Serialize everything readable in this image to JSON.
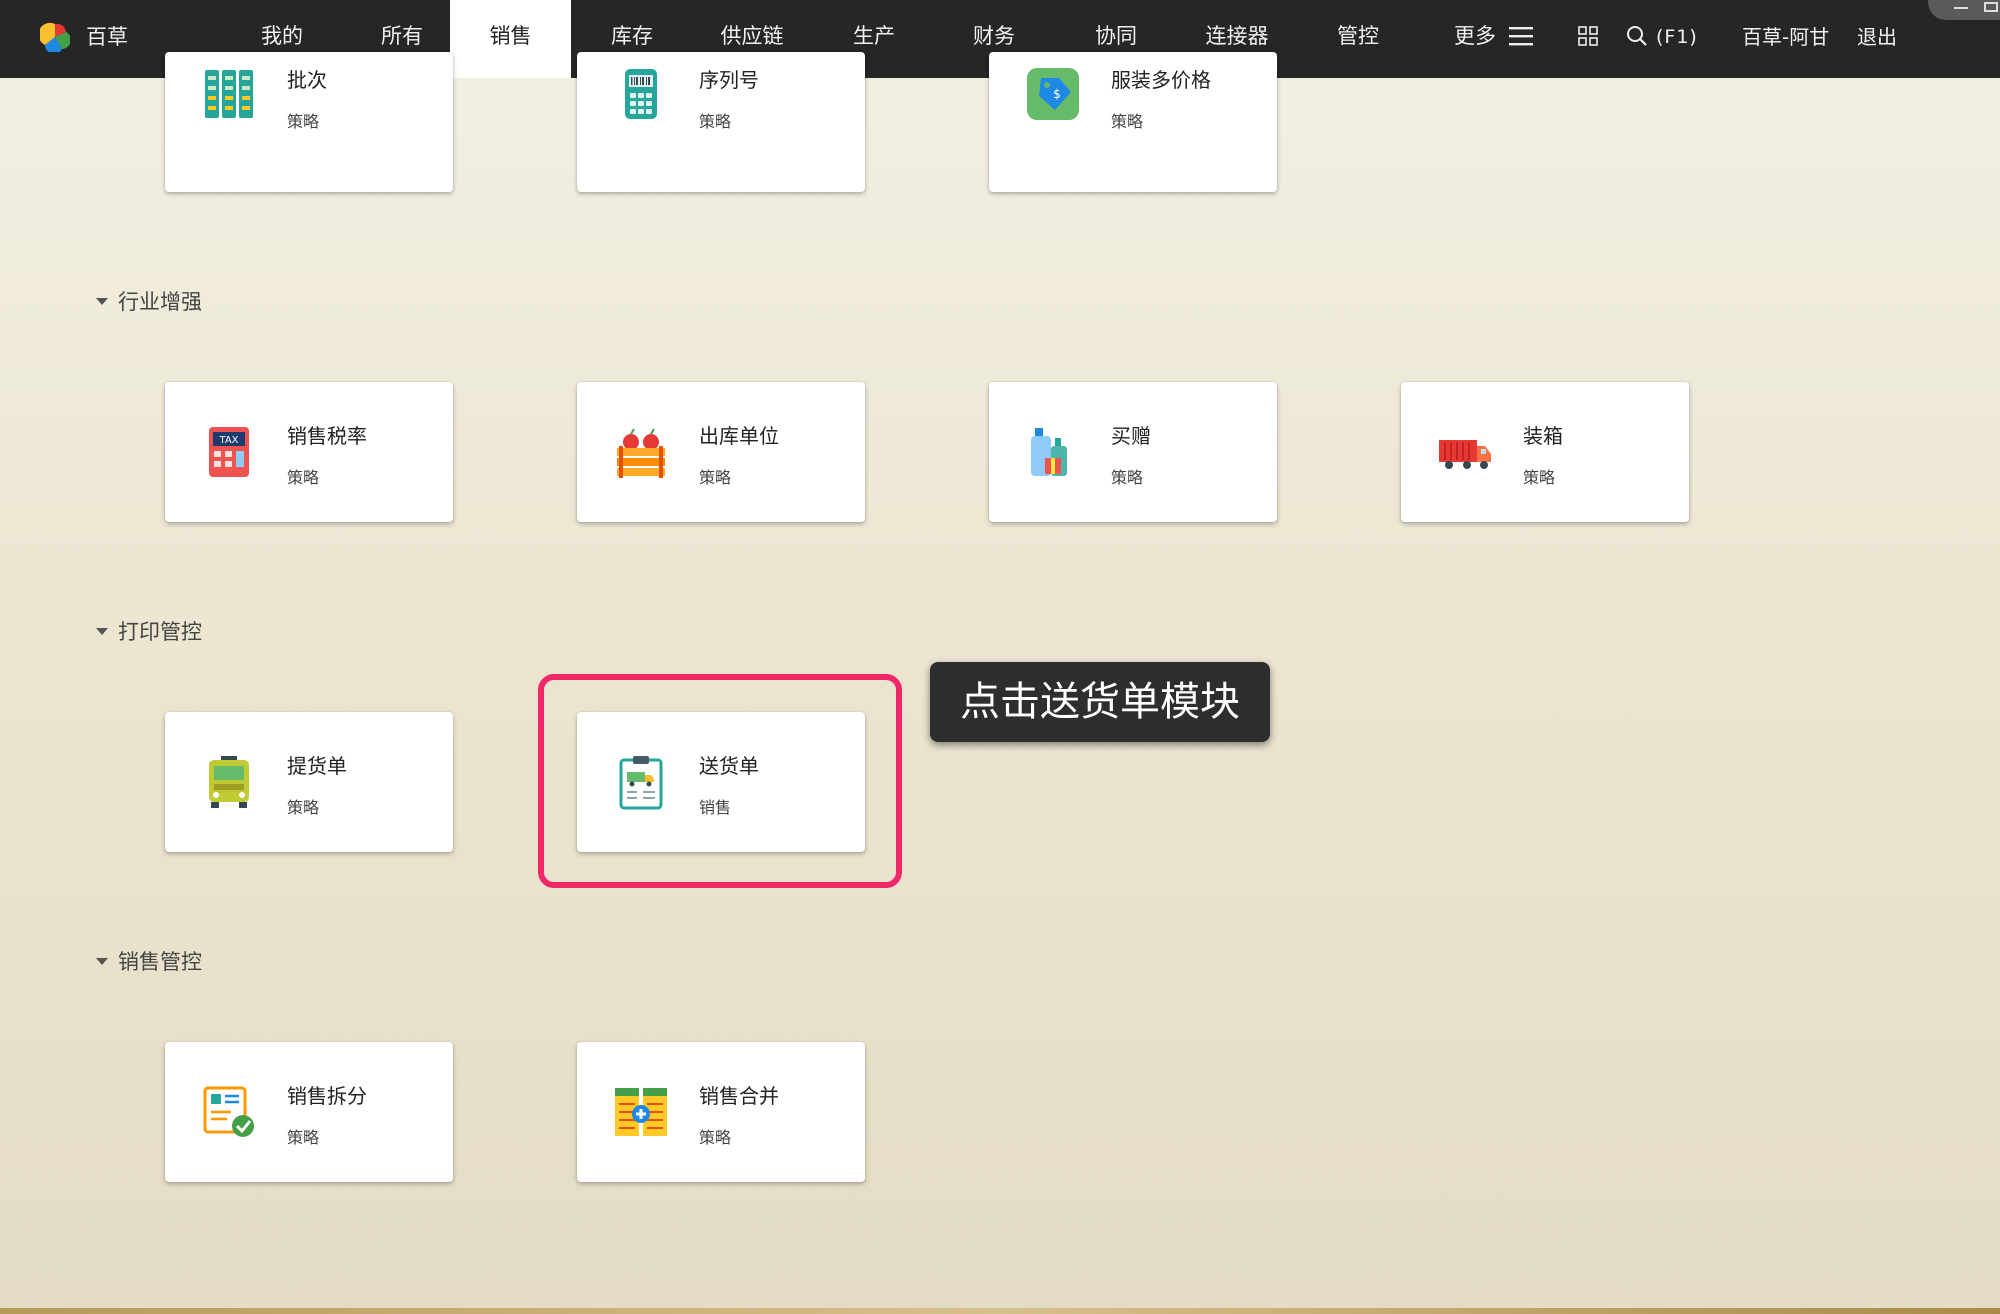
{
  "app": {
    "brand": "百草"
  },
  "nav": {
    "items": [
      {
        "label": "我的"
      },
      {
        "label": "所有"
      },
      {
        "label": "销售",
        "active": true
      },
      {
        "label": "库存"
      },
      {
        "label": "供应链"
      },
      {
        "label": "生产"
      },
      {
        "label": "财务"
      },
      {
        "label": "协同"
      },
      {
        "label": "连接器"
      },
      {
        "label": "管控"
      },
      {
        "label": "更多"
      }
    ],
    "search_shortcut": "(F1)",
    "user": "百草-阿甘",
    "logout": "退出"
  },
  "top_row": [
    {
      "title": "批次",
      "sub": "策略",
      "icon": "batch-icon"
    },
    {
      "title": "序列号",
      "sub": "策略",
      "icon": "serial-scanner-icon"
    },
    {
      "title": "服装多价格",
      "sub": "策略",
      "icon": "price-tag-icon"
    }
  ],
  "sections": [
    {
      "title": "行业增强",
      "cards": [
        {
          "title": "销售税率",
          "sub": "策略",
          "icon": "tax-calculator-icon",
          "icon_text": "TAX"
        },
        {
          "title": "出库单位",
          "sub": "策略",
          "icon": "fruit-crate-icon"
        },
        {
          "title": "买赠",
          "sub": "策略",
          "icon": "gift-bottles-icon"
        },
        {
          "title": "装箱",
          "sub": "策略",
          "icon": "truck-icon"
        }
      ]
    },
    {
      "title": "打印管控",
      "cards": [
        {
          "title": "提货单",
          "sub": "策略",
          "icon": "bus-icon"
        },
        {
          "title": "送货单",
          "sub": "销售",
          "icon": "delivery-clipboard-icon"
        }
      ]
    },
    {
      "title": "销售管控",
      "cards": [
        {
          "title": "销售拆分",
          "sub": "策略",
          "icon": "document-check-icon"
        },
        {
          "title": "销售合并",
          "sub": "策略",
          "icon": "merge-sheet-icon"
        }
      ]
    }
  ],
  "tooltip": "点击送货单模块",
  "colors": {
    "highlight": "#f0286a",
    "topbar": "#262626"
  }
}
